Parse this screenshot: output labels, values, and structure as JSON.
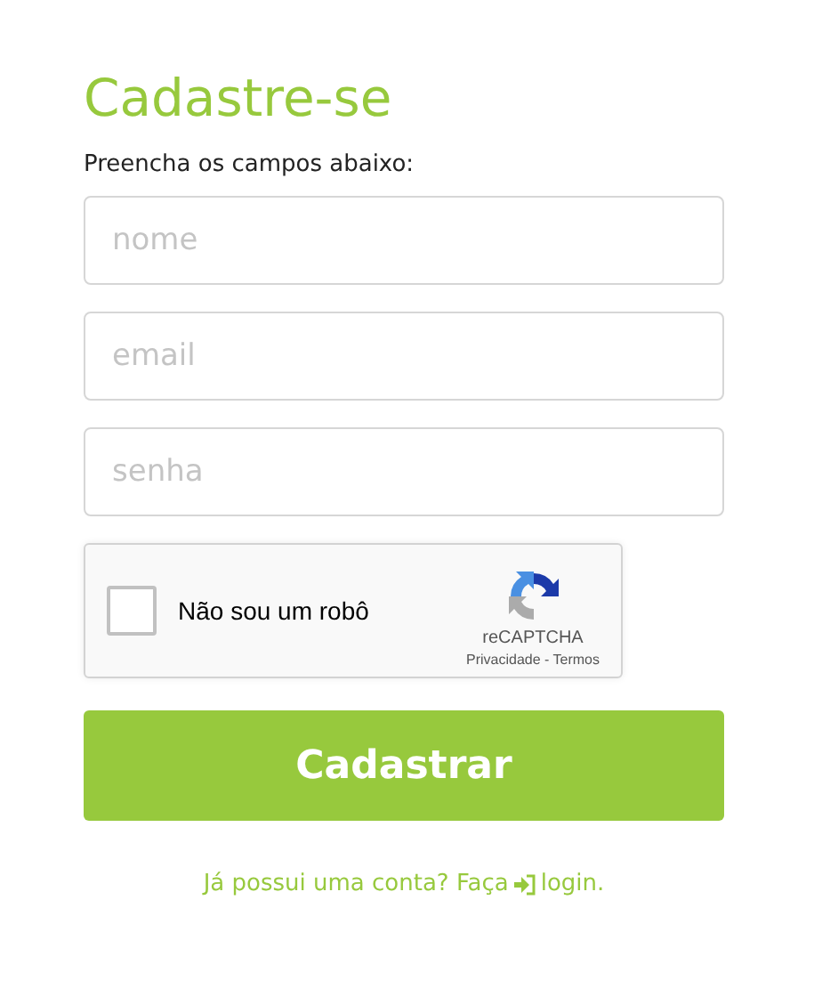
{
  "title": "Cadastre-se",
  "subtitle": "Preencha os campos abaixo:",
  "fields": [
    {
      "placeholder": "nome"
    },
    {
      "placeholder": "email"
    },
    {
      "placeholder": "senha"
    }
  ],
  "captcha": {
    "label": "Não sou um robô",
    "checked": false,
    "brand": "reCAPTCHA",
    "footer": "Privacidade - Termos"
  },
  "submit": "Cadastrar",
  "login": {
    "prompt": "Já possui uma conta? Faça",
    "link": "login."
  }
}
